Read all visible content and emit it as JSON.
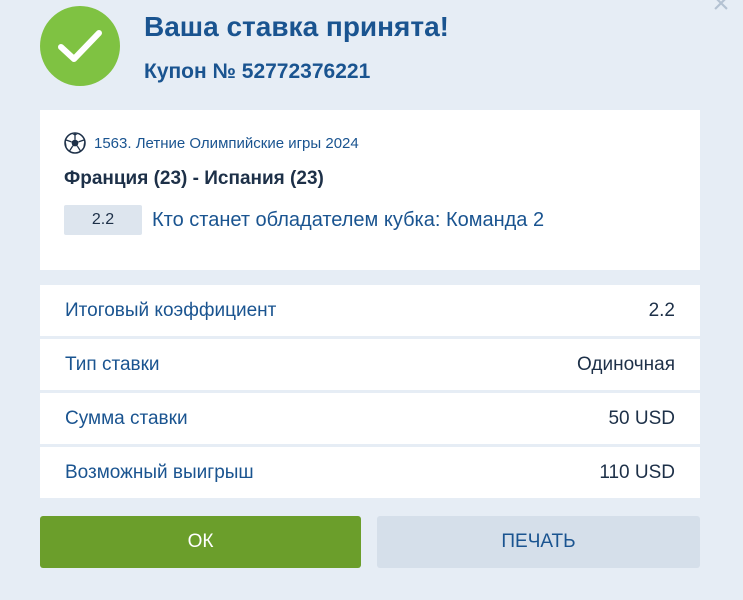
{
  "dialog": {
    "title": "Ваша ставка принята!",
    "coupon": "Купон № 52772376221",
    "close_icon": "close-icon"
  },
  "event": {
    "league": "1563. Летние Олимпийские игры 2024",
    "sport_icon": "soccer-ball-icon",
    "match": "Франция (23) - Испания (23)",
    "coefficient": "2.2",
    "market": "Кто станет обладателем кубка: Команда 2"
  },
  "summary": {
    "rows": [
      {
        "label": "Итоговый коэффициент",
        "value": "2.2"
      },
      {
        "label": "Тип ставки",
        "value": "Одиночная"
      },
      {
        "label": "Сумма ставки",
        "value": "50 USD"
      },
      {
        "label": "Возможный выигрыш",
        "value": "110 USD"
      }
    ]
  },
  "buttons": {
    "ok": "ОК",
    "print": "ПЕЧАТЬ"
  },
  "colors": {
    "accent": "#1a5490",
    "success": "#7fc242",
    "ok_button": "#6b9e2b",
    "background": "#e6edf5"
  }
}
